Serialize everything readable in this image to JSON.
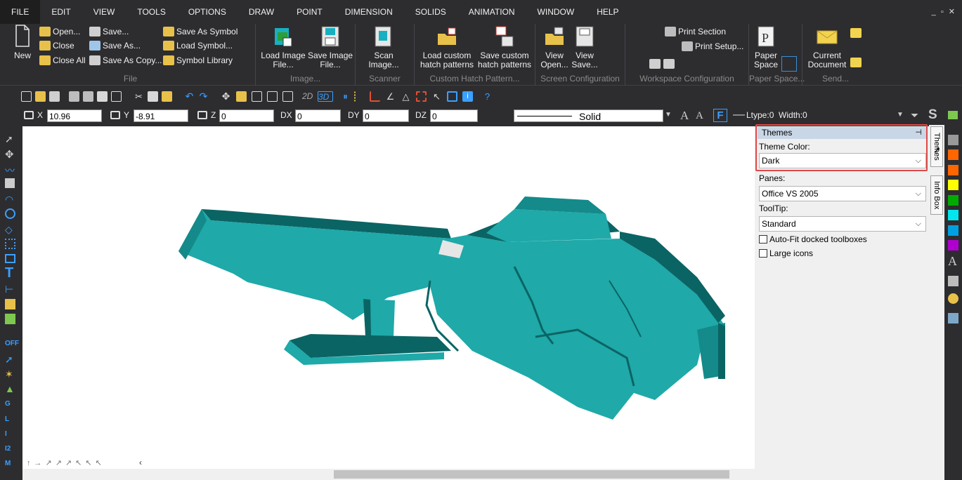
{
  "menu": {
    "items": [
      "FILE",
      "EDIT",
      "VIEW",
      "TOOLS",
      "OPTIONS",
      "DRAW",
      "POINT",
      "DIMENSION",
      "SOLIDS",
      "ANIMATION",
      "WINDOW",
      "HELP"
    ],
    "window_controls": "_ ▫ ✕"
  },
  "ribbon": {
    "file": {
      "new": "New",
      "open": "Open...",
      "close": "Close",
      "close_all": "Close All",
      "save": "Save...",
      "save_as": "Save As...",
      "save_as_copy": "Save As Copy...",
      "save_as_symbol": "Save As Symbol",
      "load_symbol": "Load Symbol...",
      "symbol_library": "Symbol Library",
      "label": "File"
    },
    "image": {
      "load": "Load Image\nFile...",
      "load_a": "Load Image",
      "load_b": "File...",
      "save_a": "Save Image",
      "save_b": "File...",
      "label": "Image..."
    },
    "scanner": {
      "scan_a": "Scan",
      "scan_b": "Image...",
      "label": "Scanner"
    },
    "hatch": {
      "load_a": "Load custom",
      "load_b": "hatch patterns",
      "save_a": "Save custom",
      "save_b": "hatch patterns",
      "label": "Custom Hatch Pattern..."
    },
    "screen": {
      "view_open_a": "View",
      "view_open_b": "Open...",
      "view_save_a": "View",
      "view_save_b": "Save...",
      "label": "Screen Configuration"
    },
    "workspace": {
      "print_section": "Print Section",
      "print_setup": "Print Setup...",
      "label": "Workspace Configuration"
    },
    "paper": {
      "a": "Paper",
      "b": "Space",
      "label": "Paper Space..."
    },
    "send": {
      "a": "Current",
      "b": "Document",
      "label": "Send..."
    }
  },
  "toolbar": {
    "mode_2d": "2D",
    "mode_3d": "3D",
    "x_label": "X",
    "x_value": "10.96",
    "y_label": "Y",
    "y_value": "-8.91",
    "z_label": "Z",
    "z_value": "0",
    "dx_label": "DX",
    "dx_value": "0",
    "dy_label": "DY",
    "dy_value": "0",
    "dz_label": "DZ",
    "dz_value": "0",
    "line_style": "Solid",
    "ltype": "Ltype:0  Width:0",
    "s_label": "S"
  },
  "left_toolbar": {
    "off": "OFF",
    "g": "G",
    "l": "L",
    "i": "I",
    "i2": "I2",
    "m": "M"
  },
  "panel": {
    "title": "Themes",
    "pin": "⊣",
    "theme_color_label": "Theme Color:",
    "theme_color_value": "Dark",
    "panes_label": "Panes:",
    "panes_value": "Office VS 2005",
    "tooltip_label": "ToolTip:",
    "tooltip_value": "Standard",
    "autofit_label": "Auto-Fit docked toolboxes",
    "large_icons_label": "Large icons"
  },
  "side_tabs": {
    "themes": "Themes",
    "info": "Info Box"
  },
  "colors": {
    "model": "#1fa9a9",
    "model_dark": "#0b6464",
    "swatches": [
      "#999999",
      "#ff6600",
      "#ff6600",
      "#ffff00",
      "#00aa00",
      "#00e5ee",
      "#00a0e0",
      "#b000d0"
    ]
  }
}
